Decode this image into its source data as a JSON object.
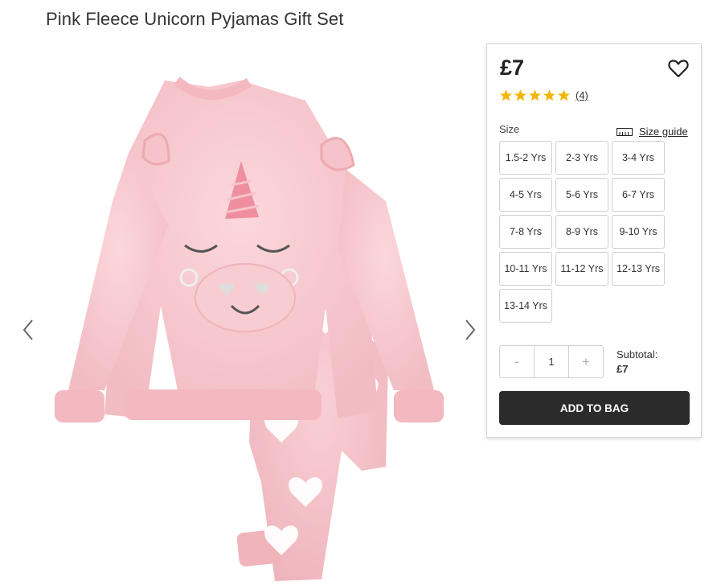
{
  "product": {
    "title": "Pink Fleece Unicorn Pyjamas Gift Set",
    "price": "£7",
    "rating_stars": 5,
    "review_count": "(4)"
  },
  "sizes": {
    "label": "Size",
    "guide_label": "Size guide",
    "options": [
      "1.5-2 Yrs",
      "2-3 Yrs",
      "3-4 Yrs",
      "4-5 Yrs",
      "5-6 Yrs",
      "6-7 Yrs",
      "7-8 Yrs",
      "8-9 Yrs",
      "9-10 Yrs",
      "10-11 Yrs",
      "11-12 Yrs",
      "12-13 Yrs",
      "13-14 Yrs"
    ]
  },
  "quantity": {
    "minus": "-",
    "value": "1",
    "plus": "+"
  },
  "subtotal": {
    "label": "Subtotal:",
    "value": "£7"
  },
  "actions": {
    "add_to_bag": "ADD TO BAG"
  },
  "icons": {
    "prev": "chevron-left-icon",
    "next": "chevron-right-icon",
    "wishlist": "heart-outline-icon",
    "star": "star-icon",
    "size_guide": "ruler-icon"
  },
  "colors": {
    "star": "#f2b705",
    "button_bg": "#2b2b2b",
    "garment_pink": "#f6c9cf"
  }
}
